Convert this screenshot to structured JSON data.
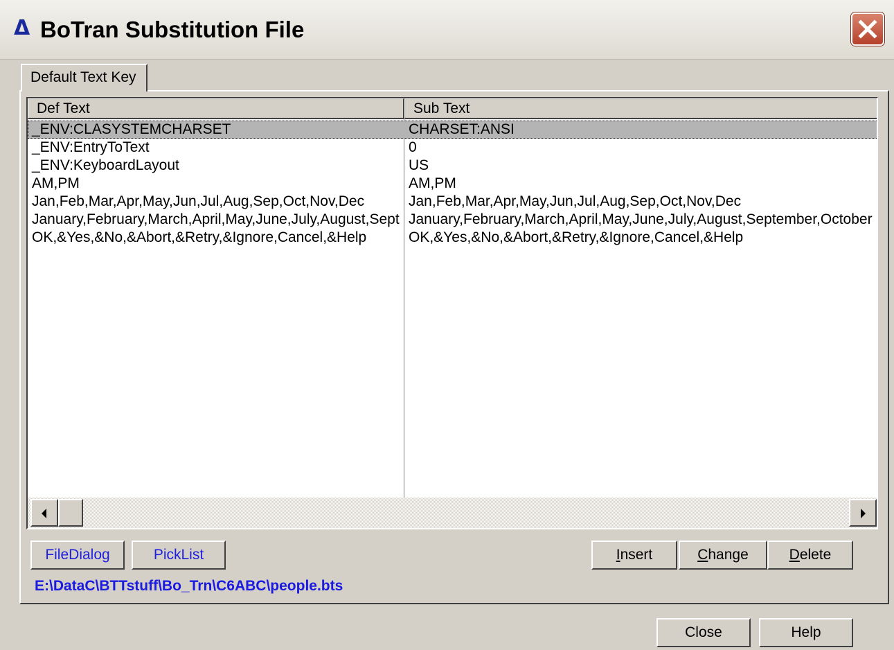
{
  "window": {
    "title_icon": "Δ",
    "title": "BoTran Substitution File",
    "close_icon": "close-x-icon"
  },
  "tabs": [
    {
      "label": "Default Text Key",
      "active": true
    }
  ],
  "list": {
    "columns": [
      "Def Text",
      "Sub Text"
    ],
    "rows": [
      {
        "def": "_ENV:CLASYSTEMCHARSET",
        "sub": "CHARSET:ANSI",
        "selected": true
      },
      {
        "def": "_ENV:EntryToText",
        "sub": "0"
      },
      {
        "def": "_ENV:KeyboardLayout",
        "sub": "US"
      },
      {
        "def": "AM,PM",
        "sub": "AM,PM"
      },
      {
        "def": "Jan,Feb,Mar,Apr,May,Jun,Jul,Aug,Sep,Oct,Nov,Dec",
        "sub": "Jan,Feb,Mar,Apr,May,Jun,Jul,Aug,Sep,Oct,Nov,Dec"
      },
      {
        "def": "January,February,March,April,May,June,July,August,Sept",
        "sub": "January,February,March,April,May,June,July,August,September,October"
      },
      {
        "def": "OK,&Yes,&No,&Abort,&Retry,&Ignore,Cancel,&Help",
        "sub": "OK,&Yes,&No,&Abort,&Retry,&Ignore,Cancel,&Help"
      }
    ]
  },
  "buttons": {
    "file_dialog": "FileDialog",
    "pick_list": "PickList",
    "insert_mnemonic": "I",
    "insert_rest": "nsert",
    "change_mnemonic": "C",
    "change_rest": "hange",
    "delete_mnemonic": "D",
    "delete_rest": "elete",
    "close": "Close",
    "help": "Help"
  },
  "file_path": "E:\\DataC\\BTTstuff\\Bo_Trn\\C6ABC\\people.bts",
  "colors": {
    "accent_blue": "#1a1ae0",
    "face": "#d4d0c8",
    "selection": "#b4b4b4"
  }
}
